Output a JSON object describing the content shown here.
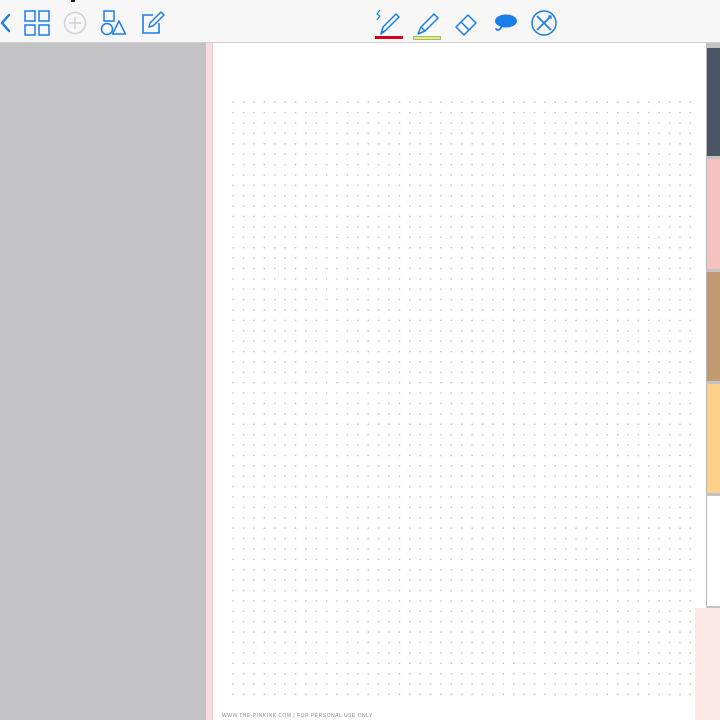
{
  "toolbar": {
    "left_icons": [
      "chevron-left-icon",
      "grid-icon",
      "add-page-icon",
      "shapes-icon",
      "compose-icon"
    ],
    "tools": [
      {
        "name": "pen",
        "icon": "pen-icon",
        "color": "#d0021b"
      },
      {
        "name": "highlighter",
        "icon": "highlighter-icon",
        "color": "#e9e88a"
      },
      {
        "name": "eraser",
        "icon": "eraser-icon"
      },
      {
        "name": "lasso",
        "icon": "lasso-icon"
      },
      {
        "name": "laser-pointer",
        "icon": "laser-pointer-icon"
      }
    ],
    "accent_color": "#1a7ee8"
  },
  "page": {
    "template": "dot grid",
    "footer_text": "WWW.THE-PINKINK.COM | FOR PERSONAL USE ONLY"
  },
  "side_tabs": [
    {
      "color": "#4a5566"
    },
    {
      "color": "#f7c1c0"
    },
    {
      "color": "#c19a71"
    },
    {
      "color": "#fdd08c"
    },
    {
      "color": "#ffffff"
    }
  ]
}
